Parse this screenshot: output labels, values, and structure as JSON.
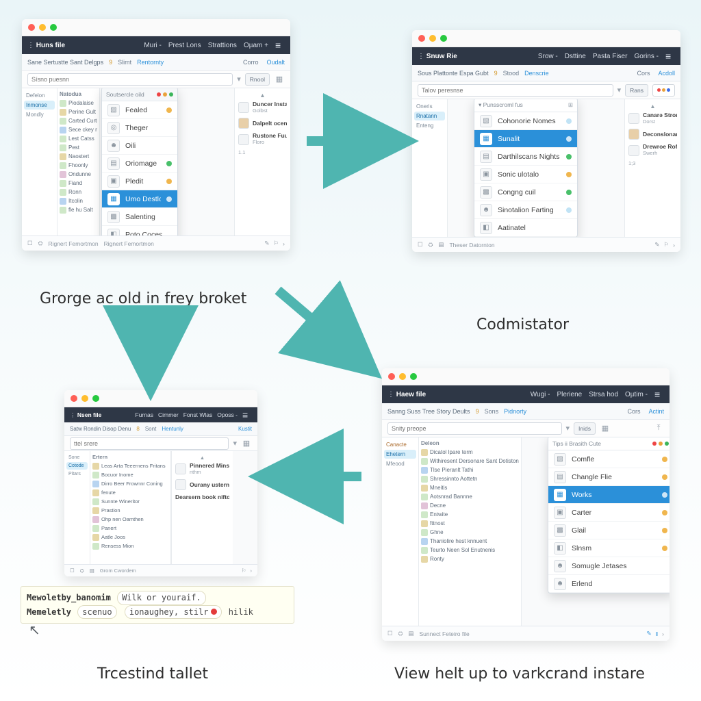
{
  "captions": {
    "c1": "Grorge ac old in frey broket",
    "c2": "Codmistator",
    "c3": "Trcestind tallet",
    "c4": "View helt up to varkcrand instare"
  },
  "code": {
    "line1a": "Mewoletby_banomim",
    "line1b": "Wilk or youraif.",
    "line2a": "Memeletly",
    "line2b": "scenuo",
    "line2c": "ionaughey, stilr",
    "line2d": "hilik"
  },
  "p1": {
    "title": "Huns file",
    "nav": [
      "Muri -",
      "Prest Lons",
      "Strattions",
      "Oµam +"
    ],
    "crumb": "Sane Sertustte Sant Delgps",
    "crumb_badge": "9",
    "tab_a": "Slimt",
    "tab_b": "Rentornty",
    "right_tab_a": "Corro",
    "right_tab_b": "Oudalt",
    "search_ph": "Sísno puesnn",
    "pill": "Rnool",
    "left": [
      "Defelon",
      "Inmonse",
      "Mondly"
    ],
    "tree_head": "Natodua",
    "tree": [
      "Piodalaise",
      "Perine Gult",
      "Carted Curter",
      "Sece ckey nem",
      "Lest Catss",
      "Pest",
      "Naostert",
      "Fhoonly",
      "Ondunne",
      "Fiand",
      "Ronn",
      "Itcolin",
      "fle hu Salt"
    ],
    "dd_head": "Soutsercle oild",
    "dd": [
      {
        "l": "Fealed",
        "b": "o"
      },
      {
        "l": "Theger",
        "b": ""
      },
      {
        "l": "Oili",
        "b": ""
      },
      {
        "l": "Oriomage",
        "b": "g"
      },
      {
        "l": "Pledit",
        "b": "o"
      },
      {
        "l": "Umo Destlo",
        "b": "sel"
      },
      {
        "l": "Salenting",
        "b": ""
      },
      {
        "l": "Poto Coces",
        "b": ""
      }
    ],
    "right": [
      {
        "t": "Duncer Instale",
        "s": "Golbst"
      },
      {
        "t": "Dalpelt ocencome",
        "s": "—"
      },
      {
        "t": "Rustone Fuuotnucs",
        "s": "Floro"
      },
      {
        "t": "—",
        "s": "1.1"
      }
    ],
    "status": "Rignert Femortmon"
  },
  "p2": {
    "title": "Snuw Rie",
    "nav": [
      "Srow -",
      "Dsttine",
      "Pasta Fiser",
      "Gorins -"
    ],
    "crumb": "Sous Plattonte Espa Gubt",
    "crumb_badge": "9",
    "tab_a": "Stood",
    "tab_b": "Denscrie",
    "right_tab_a": "Cors",
    "right_tab_b": "Acdoll",
    "search_ph": "Talov peresnse",
    "pill": "Rans",
    "left": [
      "Oneris",
      "Rnatann",
      "Enteng"
    ],
    "dd_head": "Punsscroml fus",
    "dd": [
      {
        "l": "Cohonorie Nomes",
        "b": "b"
      },
      {
        "l": "Sunalit",
        "b": "sel"
      },
      {
        "l": "Darthilscans Nights",
        "b": "g"
      },
      {
        "l": "Sonic ulotalo",
        "b": "o"
      },
      {
        "l": "Congng cuil",
        "b": "g"
      },
      {
        "l": "Sinotalion Farting",
        "b": "b"
      },
      {
        "l": "Aatinatel",
        "b": ""
      }
    ],
    "right": [
      {
        "t": "Canarə Strones",
        "s": "Dorst"
      },
      {
        "t": "Deconslonanet Filios",
        "s": "—"
      },
      {
        "t": "Drewroe Rofohlesto",
        "s": "Swerh"
      },
      {
        "t": "—",
        "s": "1;3"
      }
    ],
    "status": "Theser Datornton"
  },
  "p3": {
    "title": "Nsen file",
    "nav": [
      "Furnas",
      "Cimmer",
      "Fonst Wlas",
      "Oposs -"
    ],
    "crumb": "Satw Rondin Disop Denu",
    "tab_a": "Sont",
    "tab_b": "Hentunly",
    "right_tab_a": "Kustit",
    "search_ph": "ttel srere",
    "left": [
      "Sone",
      "Cotode",
      "Pitars"
    ],
    "tree_head": "Ertern",
    "tree": [
      "Leas Arta Teeernens Fritans",
      "Bocuor Inome",
      "Dirro Beer Frownnr Coning",
      "fenute",
      "Sunnte Wineritor",
      "Prastion",
      "Ohp nen Oamthen",
      "Panert",
      "Aatle Joos",
      "Rensess Mion"
    ],
    "right": [
      {
        "t": "Pinnered Minstock",
        "s": "nthm"
      },
      {
        "t": "Ourany usterneor",
        "s": "—"
      },
      {
        "t": "Dearsern book niftolit",
        "s": "—"
      }
    ],
    "status": "Grom Cwordem"
  },
  "p4": {
    "title": "Haew file",
    "nav": [
      "Wugi -",
      "Pleriene",
      "Strsa hod",
      "Oµtim -"
    ],
    "crumb": "Sanng Suss Tree Story Deults",
    "crumb_badge": "9",
    "tab_a": "Sons",
    "tab_b": "Pidnorty",
    "right_tab_a": "Cors",
    "right_tab_b": "Actint",
    "search_ph": "Snity preope",
    "pill": "Inids",
    "left": [
      "Canacte",
      "Ehetern",
      "Mfeood"
    ],
    "tree_head": "Deleon",
    "tree": [
      "Dicatol lpare term",
      "Withiresent Dersonare Sant Dotiston",
      "Tlse Pieranlt Tathi",
      "Shressinnto Aottetn",
      "Mneitis",
      "Aotsnrad Bannne",
      "Decne",
      "Entwite",
      "fttnost",
      "Ghne",
      "Thaniolire hest knnuent",
      "Teurto Neen Sol Enutnenis",
      "Ronty"
    ],
    "dd_head": "Tips ii Brasith Cute",
    "dd": [
      {
        "l": "Comfle",
        "b": "o"
      },
      {
        "l": "Changle Flie",
        "b": "o"
      },
      {
        "l": "Works",
        "b": "sel"
      },
      {
        "l": "Carter",
        "b": "o"
      },
      {
        "l": "Glail",
        "b": "o"
      },
      {
        "l": "Slnsm",
        "b": "o"
      },
      {
        "l": "Somugle Jetases",
        "b": ""
      },
      {
        "l": "Erlend",
        "b": ""
      }
    ],
    "status": "Sunnect Feteiro file"
  }
}
